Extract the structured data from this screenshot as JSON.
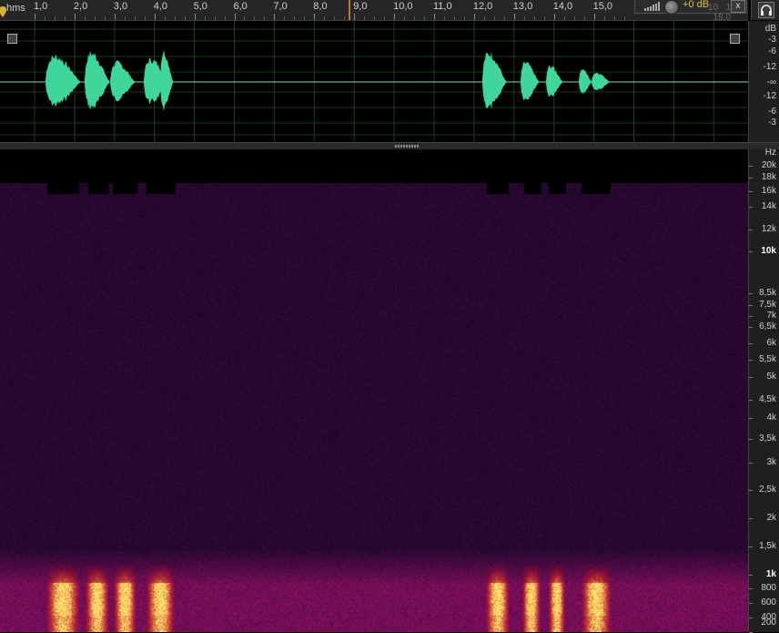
{
  "ruler": {
    "unit_label": "hms",
    "ticks": [
      "1,0",
      "2,0",
      "3,0",
      "4,0",
      "5,0",
      "6,0",
      "7,0",
      "8,0",
      "9,0",
      "10,0",
      "11,0",
      "12,0",
      "13,0",
      "14,0",
      "15,0"
    ]
  },
  "toolbar": {
    "gain_label": "+0 dB",
    "ghost_labels": [
      "10",
      "16",
      "18,0"
    ],
    "close_label": "x"
  },
  "waveform": {
    "db_scale": [
      "dB",
      "-3",
      "-6",
      "-12",
      "-∞",
      "-12",
      "-6",
      "-3"
    ]
  },
  "spectrogram": {
    "hz_scale": [
      {
        "label": "Hz",
        "major": false
      },
      {
        "label": "20k",
        "major": false
      },
      {
        "label": "18k",
        "major": false
      },
      {
        "label": "16k",
        "major": false
      },
      {
        "label": "14k",
        "major": false
      },
      {
        "label": "12k",
        "major": false
      },
      {
        "label": "10k",
        "major": true
      },
      {
        "label": "8,5k",
        "major": false
      },
      {
        "label": "7,5k",
        "major": false
      },
      {
        "label": "7k",
        "major": false
      },
      {
        "label": "6,5k",
        "major": false
      },
      {
        "label": "6k",
        "major": false
      },
      {
        "label": "5,5k",
        "major": false
      },
      {
        "label": "5k",
        "major": false
      },
      {
        "label": "4,5k",
        "major": false
      },
      {
        "label": "4k",
        "major": false
      },
      {
        "label": "3,5k",
        "major": false
      },
      {
        "label": "3k",
        "major": false
      },
      {
        "label": "2,5k",
        "major": false
      },
      {
        "label": "2k",
        "major": false
      },
      {
        "label": "1,5k",
        "major": false
      },
      {
        "label": "1k",
        "major": true
      },
      {
        "label": "800",
        "major": false
      },
      {
        "label": "600",
        "major": false
      },
      {
        "label": "400",
        "major": false
      },
      {
        "label": "200",
        "major": false
      }
    ]
  },
  "colors": {
    "waveform": "#3ed69a",
    "spectrogram_base": "#3a1850",
    "spectrogram_hot": "#ffe27a",
    "accent_gain": "#e0c040",
    "cursor": "#b87820"
  },
  "icons": {
    "headphones": "headphones-icon",
    "close": "close-icon",
    "volume": "volume-bars-icon",
    "knob": "gain-knob-icon",
    "pin": "marker-pin-icon"
  }
}
